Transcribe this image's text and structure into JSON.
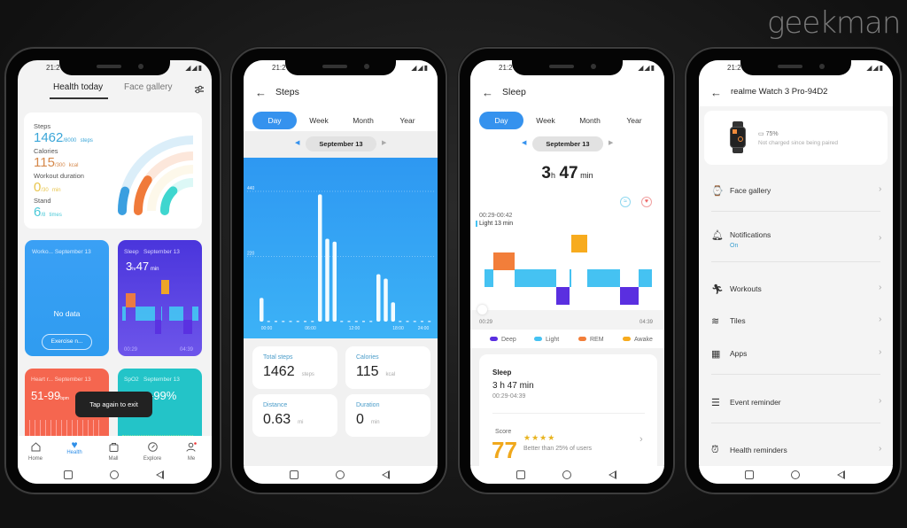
{
  "brand": "geekman",
  "status_time": "21:2",
  "phone1": {
    "tabs": [
      "Health today",
      "Face gallery"
    ],
    "summary": {
      "steps": {
        "label": "Steps",
        "value": "1462",
        "goal": "/8000",
        "unit": "steps",
        "progress": 0.18,
        "color": "#3a9fe0"
      },
      "calories": {
        "label": "Calories",
        "value": "115",
        "goal": "/300",
        "unit": "kcal",
        "progress": 0.38,
        "color": "#f07a3a"
      },
      "workout": {
        "label": "Workout duration",
        "value": "0",
        "goal": "/30",
        "unit": "min",
        "progress": 0,
        "color": "#f3d98a"
      },
      "stand": {
        "label": "Stand",
        "value": "6",
        "goal": "/8",
        "unit": "times",
        "progress": 0.5,
        "color": "#3fd6cf"
      }
    },
    "workout_card": {
      "title": "Worko...",
      "date": "September 13",
      "empty": "No data",
      "button": "Exercise n..."
    },
    "sleep_card": {
      "title": "Sleep",
      "date": "September 13",
      "hours": "3",
      "h": "hr",
      "mins": "47",
      "m": "min",
      "start": "00:29",
      "end": "04:39"
    },
    "heart_card": {
      "title": "Heart r...",
      "date": "September 13",
      "value": "51-99",
      "unit": "bpm"
    },
    "spo2_card": {
      "title": "SpO2",
      "date": "September 13",
      "value": "-99%"
    },
    "toast": "Tap again to exit",
    "nav": [
      "Home",
      "Health",
      "Mall",
      "Explore",
      "Me"
    ],
    "active_nav": "Health"
  },
  "phone2": {
    "title": "Steps",
    "periods": [
      "Day",
      "Week",
      "Month",
      "Year"
    ],
    "date": "September 13",
    "chart_data": {
      "type": "bar",
      "yticks": [
        440,
        220
      ],
      "ylim": [
        0,
        440
      ],
      "xticks": [
        "00:00",
        "06:00",
        "12:00",
        "18:00",
        "24:00"
      ],
      "values": [
        80,
        0,
        0,
        0,
        0,
        0,
        0,
        0,
        430,
        280,
        270,
        0,
        0,
        0,
        0,
        0,
        160,
        145,
        65,
        0,
        0,
        0,
        0,
        0
      ]
    },
    "stats": [
      {
        "label": "Total steps",
        "value": "1462",
        "unit": "steps"
      },
      {
        "label": "Calories",
        "value": "115",
        "unit": "kcal"
      },
      {
        "label": "Distance",
        "value": "0.63",
        "unit": "mi"
      },
      {
        "label": "Duration",
        "value": "0",
        "unit": "min"
      }
    ]
  },
  "phone3": {
    "title": "Sleep",
    "periods": [
      "Day",
      "Week",
      "Month",
      "Year"
    ],
    "date": "September 13",
    "total": {
      "h": "3",
      "hu": "h",
      "m": "47",
      "mu": "min"
    },
    "tooltip": {
      "range": "00:29-00:42",
      "detail": "Light 13 min"
    },
    "chart_data": {
      "type": "timeline",
      "start": "00:29",
      "end": "04:39",
      "segments": [
        {
          "stage": "Light",
          "from": "00:29",
          "to": "00:42"
        },
        {
          "stage": "REM",
          "from": "00:42",
          "to": "01:14"
        },
        {
          "stage": "Light",
          "from": "01:14",
          "to": "02:16"
        },
        {
          "stage": "Deep",
          "from": "02:16",
          "to": "02:36"
        },
        {
          "stage": "Light",
          "from": "02:36",
          "to": "02:38"
        },
        {
          "stage": "Awake",
          "from": "02:38",
          "to": "03:02"
        },
        {
          "stage": "Light",
          "from": "03:02",
          "to": "03:51"
        },
        {
          "stage": "Deep",
          "from": "03:51",
          "to": "04:19"
        },
        {
          "stage": "Light",
          "from": "04:19",
          "to": "04:39"
        }
      ],
      "legend": [
        {
          "name": "Deep",
          "color": "#5a2fe0"
        },
        {
          "name": "Light",
          "color": "#45c2f2"
        },
        {
          "name": "REM",
          "color": "#f27e3a"
        },
        {
          "name": "Awake",
          "color": "#f7ab1e"
        }
      ]
    },
    "detail": {
      "title": "Sleep",
      "duration": "3 h 47 min",
      "range": "00:29-04:39",
      "score_label": "Score",
      "score": "77",
      "stars": "★★★★",
      "compare": "Better than 25% of users"
    }
  },
  "phone4": {
    "title": "realme Watch 3 Pro-94D2",
    "battery": "75%",
    "charge_note": "Not charged since being paired",
    "items": [
      {
        "label": "Face gallery",
        "icon": "watch-icon"
      },
      {
        "label": "Notifications",
        "sub": "On",
        "icon": "bell-icon"
      },
      {
        "label": "Workouts",
        "icon": "running-icon"
      },
      {
        "label": "Tiles",
        "icon": "layers-icon"
      },
      {
        "label": "Apps",
        "icon": "apps-grid-icon"
      },
      {
        "label": "Event reminder",
        "icon": "list-icon"
      },
      {
        "label": "Health reminders",
        "icon": "alarm-clock-icon"
      }
    ]
  }
}
